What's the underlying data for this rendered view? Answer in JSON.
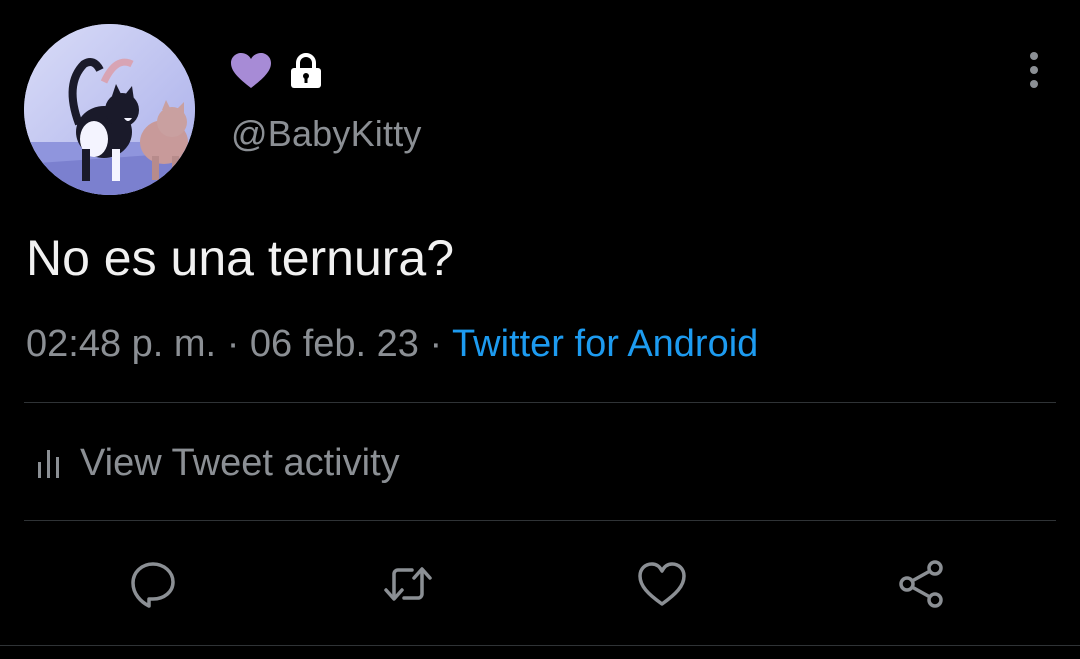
{
  "tweet": {
    "display_name_emojis": [
      "purple-heart",
      "lock"
    ],
    "handle": "@BabyKitty",
    "text": "No es una ternura?",
    "time": "02:48 p. m.",
    "separator": "·",
    "date": "06 feb. 23",
    "source": "Twitter for Android"
  },
  "activity": {
    "label": "View Tweet activity"
  },
  "actions": {
    "reply_icon": "reply-icon",
    "retweet_icon": "retweet-icon",
    "like_icon": "heart-icon",
    "share_icon": "share-icon"
  },
  "colors": {
    "background": "#000000",
    "text": "#f1f1f1",
    "muted": "#8b8f94",
    "link": "#1d9bf0",
    "divider": "#2f3336",
    "heart_emoji": "#a78bd6"
  }
}
